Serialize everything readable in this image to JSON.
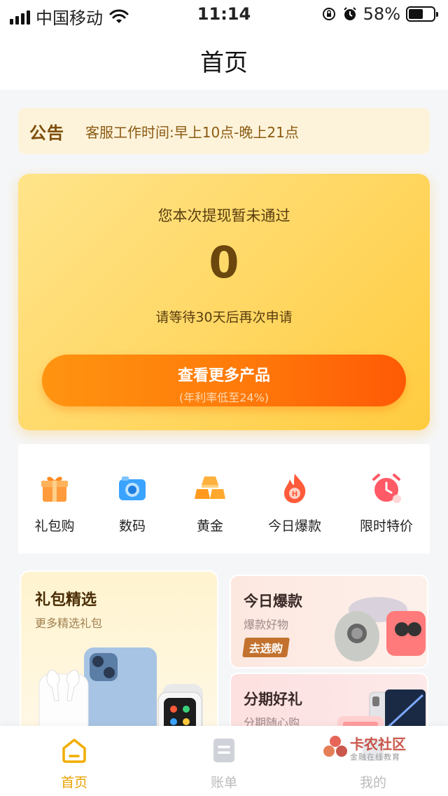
{
  "status_bar": {
    "carrier": "中国移动",
    "time": "11:14",
    "battery_percent": "58%",
    "battery_level": 0.58
  },
  "header": {
    "title": "首页"
  },
  "notice": {
    "tag": "公告",
    "text": "客服工作时间:早上10点-晚上21点"
  },
  "withdraw_card": {
    "title": "您本次提现暂未通过",
    "amount": "0",
    "subtitle": "请等待30天后再次申请",
    "button_label": "查看更多产品",
    "button_sub": "(年利率低至24%)"
  },
  "categories": [
    {
      "label": "礼包购",
      "icon": "gift-icon"
    },
    {
      "label": "数码",
      "icon": "camera-icon"
    },
    {
      "label": "黄金",
      "icon": "gold-bar-icon"
    },
    {
      "label": "今日爆款",
      "icon": "fire-icon"
    },
    {
      "label": "限时特价",
      "icon": "alarm-clock-icon"
    }
  ],
  "promos": {
    "gift_select": {
      "title": "礼包精选",
      "subtitle": "更多精选礼包"
    },
    "hot_today": {
      "title": "今日爆款",
      "subtitle": "爆款好物",
      "button": "去选购"
    },
    "installment": {
      "title": "分期好礼",
      "subtitle": "分期随心购"
    }
  },
  "tabs": [
    {
      "label": "首页",
      "icon": "home-icon",
      "active": true
    },
    {
      "label": "账单",
      "icon": "bill-icon",
      "active": false
    },
    {
      "label": "我的",
      "icon": "profile-icon",
      "active": false
    }
  ],
  "watermark": {
    "brand": "卡农社区",
    "tagline": "金融在线教育"
  },
  "colors": {
    "accent_orange": "#ff7a0a",
    "card_yellow": "#ffd866",
    "active_tab": "#e9a200",
    "notice_bg": "#fdf3da"
  }
}
